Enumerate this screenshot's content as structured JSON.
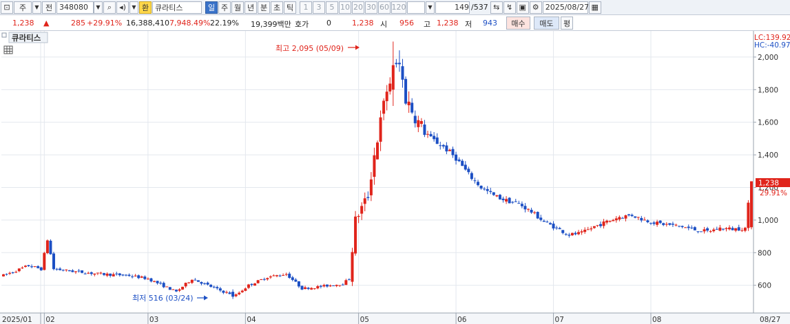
{
  "toolbar": {
    "period_type": "주",
    "prev_label": "전",
    "stock_code": "348080",
    "exchange_label": "환",
    "stock_name": "큐라티스",
    "period_tabs": [
      "일",
      "주",
      "월",
      "년",
      "분",
      "초",
      "틱"
    ],
    "interval_tabs": [
      "1",
      "3",
      "5",
      "10",
      "20",
      "30",
      "60",
      "120"
    ],
    "page_position": "149",
    "page_total": "/537",
    "date": "2025/08/27"
  },
  "quote": {
    "price": "1,238",
    "change": "285",
    "change_pct": "+29.91%",
    "volume": "16,388,410",
    "volume_pct": "7,948.49%",
    "turnover": "22.19%",
    "amount": "19,399백만",
    "hoga_label": "호가",
    "hoga_value": "0",
    "hoga_price": "1,238",
    "open_label": "시",
    "open_value": "956",
    "high_label": "고",
    "high_value": "1,238",
    "low_label": "저",
    "low_value": "943",
    "buy_label": "매수",
    "sell_label": "매도",
    "extra_label": "평"
  },
  "chart": {
    "stock_label": "큐라티스",
    "lc_label": "LC:139.92",
    "hc_label": "HC:-40.97",
    "max_annotation": "최고 2,095 (05/09)",
    "min_annotation": "최저 516 (03/24)",
    "last_price_tag": "1,238",
    "last_pct_tag": "29.91%",
    "colors": {
      "up": "#e0241b",
      "down": "#1c4fc4",
      "grid": "#e3e7ee"
    }
  },
  "chart_data": {
    "type": "candlestick",
    "y_ticks": [
      "600",
      "800",
      "1,000",
      "1,200",
      "1,400",
      "1,600",
      "1,800",
      "2,000"
    ],
    "y_tick_values": [
      600,
      800,
      1000,
      1200,
      1400,
      1600,
      1800,
      2000
    ],
    "x_ticks": [
      "2025/01",
      "02",
      "03",
      "04",
      "05",
      "06",
      "07",
      "08",
      "08/27"
    ],
    "ylim": [
      430,
      2160
    ],
    "x_tick_index": [
      0,
      13,
      46,
      77,
      113,
      144,
      175,
      206,
      238
    ],
    "num_bars": 239,
    "max": {
      "value": 2095,
      "date": "05/09"
    },
    "min": {
      "value": 516,
      "date": "03/24"
    },
    "last": {
      "open": 956,
      "high": 1238,
      "low": 943,
      "close": 1238
    }
  }
}
